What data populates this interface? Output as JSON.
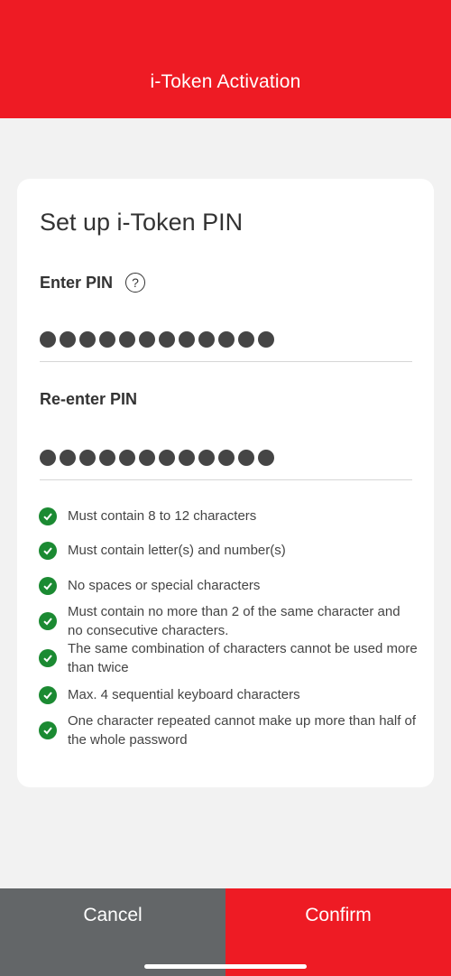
{
  "header": {
    "title": "i-Token Activation"
  },
  "card": {
    "title": "Set up i-Token PIN",
    "pin": {
      "label": "Enter PIN",
      "help_icon": "question-circle-icon",
      "masked_length": 12
    },
    "repin": {
      "label": "Re-enter PIN",
      "masked_length": 12
    },
    "rules": [
      {
        "text": "Must contain 8 to 12 characters",
        "met": true
      },
      {
        "text": "Must contain letter(s) and number(s)",
        "met": true
      },
      {
        "text": "No spaces or special characters",
        "met": true
      },
      {
        "text": "Must contain no more than 2 of the same character and no consecutive characters.",
        "met": true
      },
      {
        "text": "The same combination of characters cannot be used more than twice",
        "met": true
      },
      {
        "text": "Max. 4 sequential keyboard characters",
        "met": true
      },
      {
        "text": "One character repeated cannot make up more than half of the whole password",
        "met": true
      }
    ]
  },
  "footer": {
    "cancel_label": "Cancel",
    "confirm_label": "Confirm"
  },
  "colors": {
    "brand_red": "#ee1b24",
    "success_green": "#1b8a32",
    "cancel_gray": "#636668"
  }
}
